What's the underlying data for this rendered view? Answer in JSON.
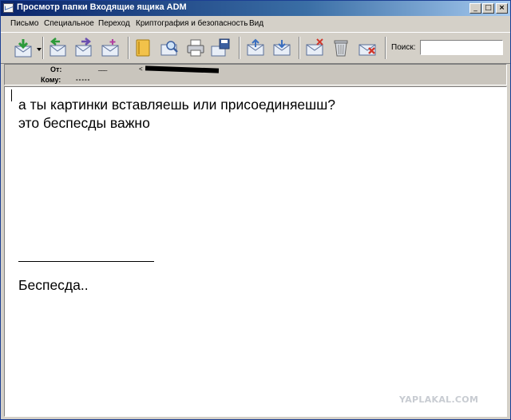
{
  "window": {
    "title": "Просмотр папки Входящие ящика ADM",
    "controls": {
      "minimize": "_",
      "maximize": "□",
      "close": "×"
    }
  },
  "menu": {
    "items": [
      "Письмо",
      "Специальное",
      "Переход",
      "Криптография и безопасность",
      "Вид"
    ]
  },
  "toolbar": {
    "search_label": "Поиск:",
    "search_value": ""
  },
  "message_header": {
    "from_label": "От:",
    "from_value_prefix": "<",
    "to_label": "Кому:",
    "to_value": "-----"
  },
  "message": {
    "lines": [
      "а ты картинки вставляешь или присоединяешш?",
      "это беспесды важно"
    ],
    "signature": "Беспесда.."
  },
  "watermark": "YAPLAKAL.COM"
}
